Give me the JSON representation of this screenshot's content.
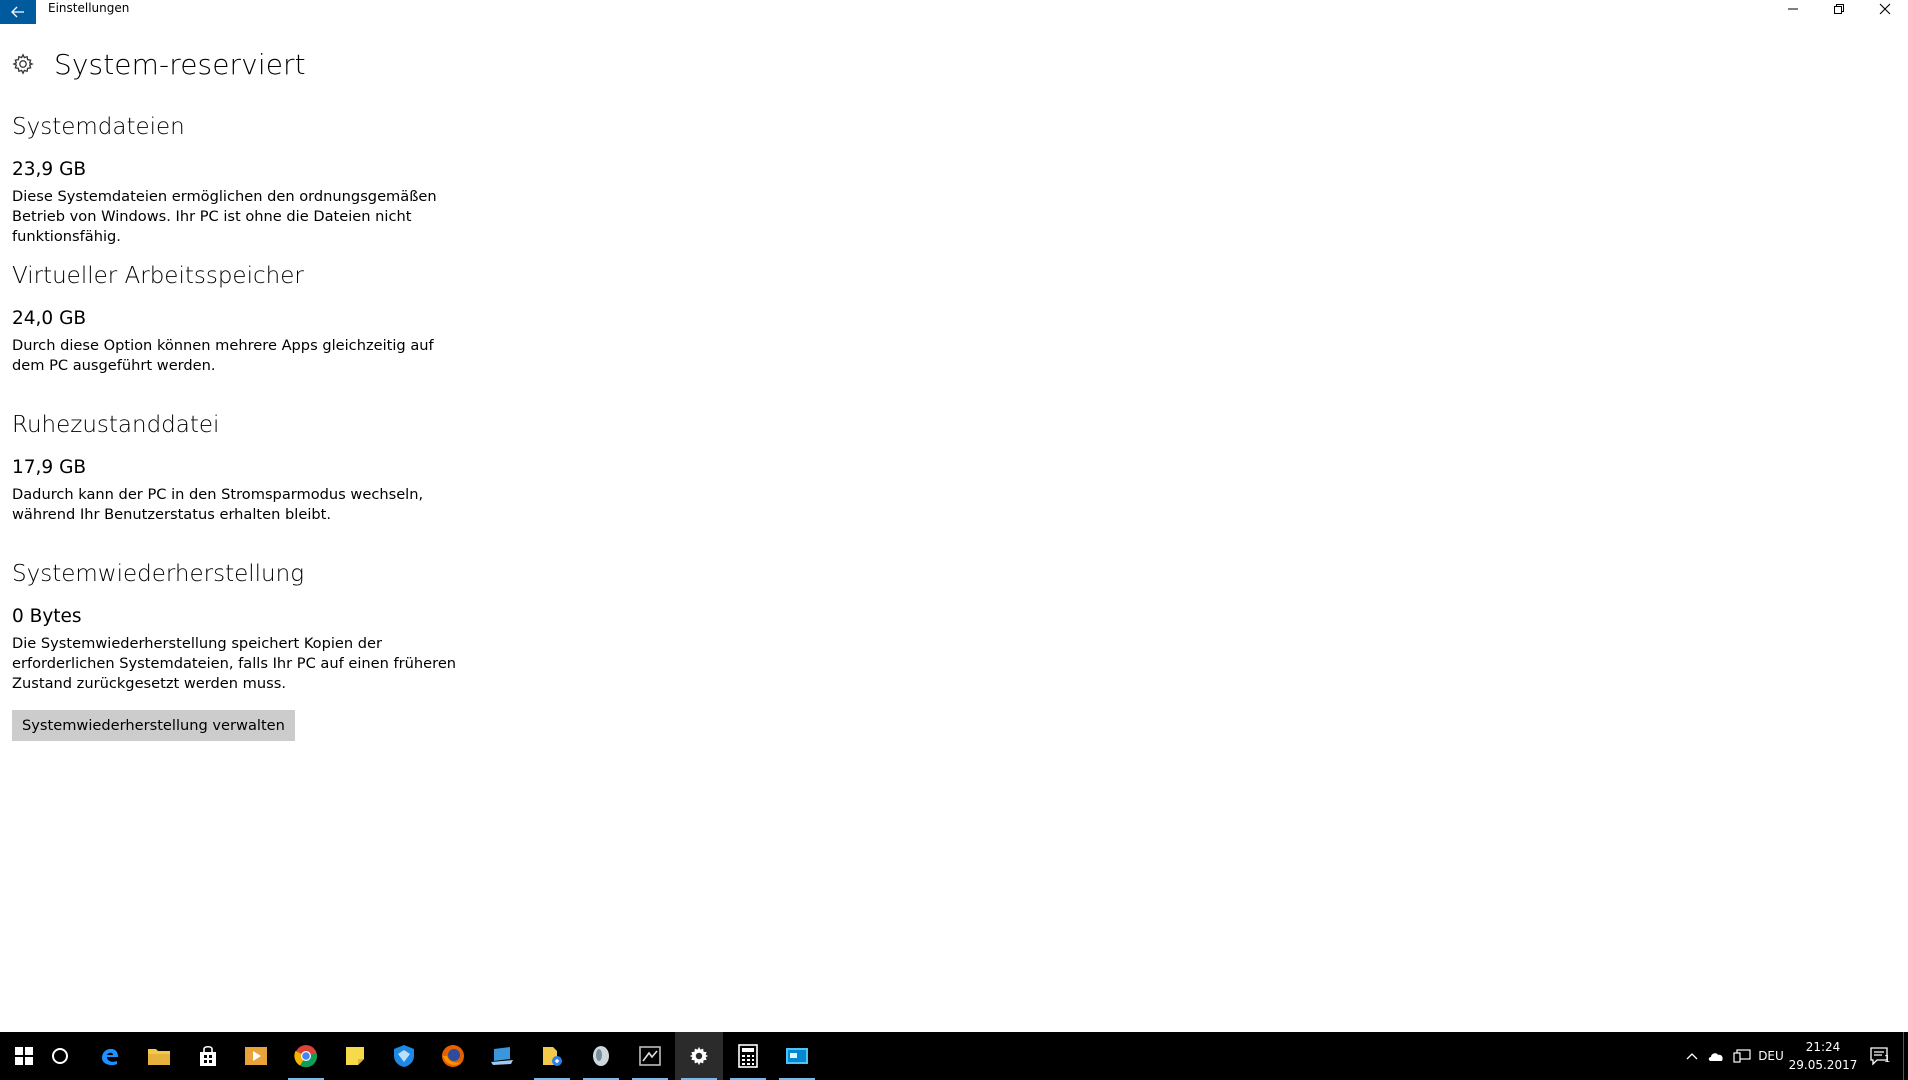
{
  "window": {
    "app_title": "Einstellungen"
  },
  "page": {
    "title": "System-reserviert"
  },
  "sections": [
    {
      "title": "Systemdateien",
      "size": "23,9 GB",
      "description": "Diese Systemdateien ermöglichen den ordnungsgemäßen Betrieb von Windows. Ihr PC ist ohne die Dateien nicht funktionsfähig."
    },
    {
      "title": "Virtueller Arbeitsspeicher",
      "size": "24,0 GB",
      "description": "Durch diese Option können mehrere Apps gleichzeitig auf dem PC ausgeführt werden."
    },
    {
      "title": "Ruhezustanddatei",
      "size": "17,9 GB",
      "description": "Dadurch kann der PC in den Stromsparmodus wechseln, während Ihr Benutzerstatus erhalten bleibt."
    },
    {
      "title": "Systemwiederherstellung",
      "size": "0 Bytes",
      "description": "Die Systemwiederherstellung speichert Kopien der erforderlichen Systemdateien, falls Ihr PC auf einen früheren Zustand zurückgesetzt werden muss."
    }
  ],
  "manage_button": {
    "label": "Systemwiederherstellung verwalten"
  },
  "taskbar": {
    "apps": [
      {
        "name": "chrome-icon",
        "color": "#db4437"
      },
      {
        "name": "sticky-notes-icon",
        "color": "#f7d94c"
      },
      {
        "name": "shield-app-icon",
        "color": "#1e88e5"
      },
      {
        "name": "firefox-icon",
        "color": "#e66000"
      },
      {
        "name": "laptop-app-icon",
        "color": "#3a96dd"
      },
      {
        "name": "file-app-icon",
        "color": "#f2c94c"
      },
      {
        "name": "round-app-icon",
        "color": "#cfd8dc"
      },
      {
        "name": "window-app-icon",
        "color": "#9e9e9e"
      },
      {
        "name": "settings-icon",
        "color": "#ffffff"
      },
      {
        "name": "calculator-icon",
        "color": "#ffffff"
      },
      {
        "name": "remote-desktop-icon",
        "color": "#4fc3f7"
      }
    ],
    "language": "DEU",
    "time": "21:24",
    "date": "29.05.2017",
    "notification_count": "1"
  },
  "colors": {
    "accent": "#005a9e",
    "button_bg": "#cccccc",
    "taskbar_bg": "#000000",
    "taskbar_underline": "#76b9ed"
  }
}
